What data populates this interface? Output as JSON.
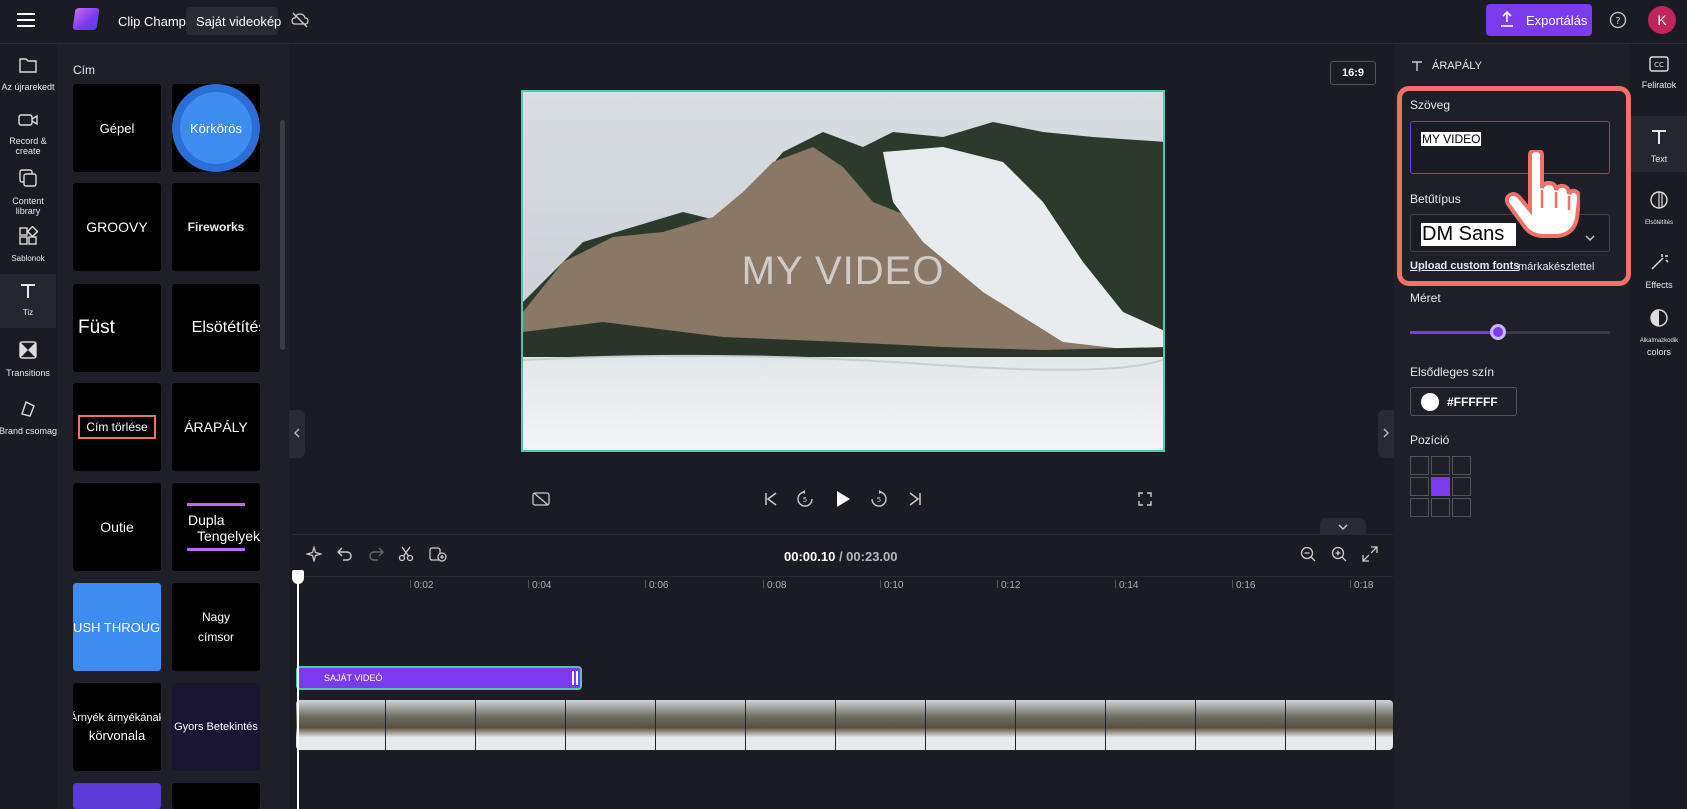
{
  "app": {
    "brand_name": "Clip Champ",
    "project_title": "Saját videokép",
    "export_label": "Exportálás",
    "avatar_initial": "K"
  },
  "left_nav": {
    "items": [
      {
        "label": "Az újrarekedt",
        "icon": "folder-icon"
      },
      {
        "label": "Record &\ncreate",
        "icon": "camera-icon"
      },
      {
        "label": "Content\nlibrary",
        "icon": "library-icon"
      },
      {
        "label": "Sablonok",
        "icon": "templates-icon"
      },
      {
        "label": "Tiz",
        "icon": "text-icon"
      },
      {
        "label": "Transitions",
        "icon": "transitions-icon"
      },
      {
        "label": "Brand",
        "icon": "brand-icon"
      }
    ],
    "brand_suffix": "csomag"
  },
  "panel": {
    "title": "Cím",
    "tiles": [
      {
        "label": "Gépel"
      },
      {
        "label": "Körkörös"
      },
      {
        "label": "GROOVY"
      },
      {
        "label": "Fireworks"
      },
      {
        "label": "Füst"
      },
      {
        "label": "Elsötétítés"
      },
      {
        "label": "Cím törlése"
      },
      {
        "label": "ÁRAPÁLY"
      },
      {
        "label": "Outie"
      },
      {
        "label": "Dupla",
        "sub": "Tengelyek"
      },
      {
        "label": "PUSH THROUGH"
      },
      {
        "label": "Nagy",
        "sub": "címsor"
      },
      {
        "label": "Árnyék árnyékának",
        "sub": "körvonala"
      },
      {
        "label": "Gyors Betekintés"
      }
    ]
  },
  "stage": {
    "aspect_ratio": "16:9",
    "preview_text": "MY VIDEO"
  },
  "timeline": {
    "current_time": "00:00.10",
    "separator": " / ",
    "total_time": "00:23.00",
    "ticks": [
      "0:02",
      "0:04",
      "0:06",
      "0:08",
      "0:10",
      "0:12",
      "0:14",
      "0:16",
      "0:18"
    ],
    "text_clip_label": "SAJÁT VIDEÓ"
  },
  "properties": {
    "header": "ÁRAPÁLY",
    "text_label": "Szöveg",
    "text_value": "MY VIDEO",
    "font_label": "Betűtípus",
    "font_value": "DM Sans",
    "upload_fonts": "Upload custom fonts",
    "brand_kit_text": "márkakészlettel",
    "size_label": "Méret",
    "size_value": 0.44,
    "primary_color_label": "Elsődleges szín",
    "primary_color": "#FFFFFF",
    "position_label": "Pozíció",
    "position_selected": "middle-center"
  },
  "right_rail": {
    "items": [
      {
        "label": "Feliratok",
        "icon": "captions-icon"
      },
      {
        "label": "Text",
        "icon": "text-icon"
      },
      {
        "label": "Elsötétítés",
        "icon": "fade-icon"
      },
      {
        "label": "Effects",
        "icon": "effects-icon"
      },
      {
        "label": "Alkalmazkodik",
        "sub": "colors",
        "icon": "adjust-colors-icon"
      }
    ]
  },
  "colors": {
    "accent": "#7c3aed",
    "highlight": "#f07167",
    "selection": "#4cc9b0",
    "background": "#1b1b24"
  }
}
